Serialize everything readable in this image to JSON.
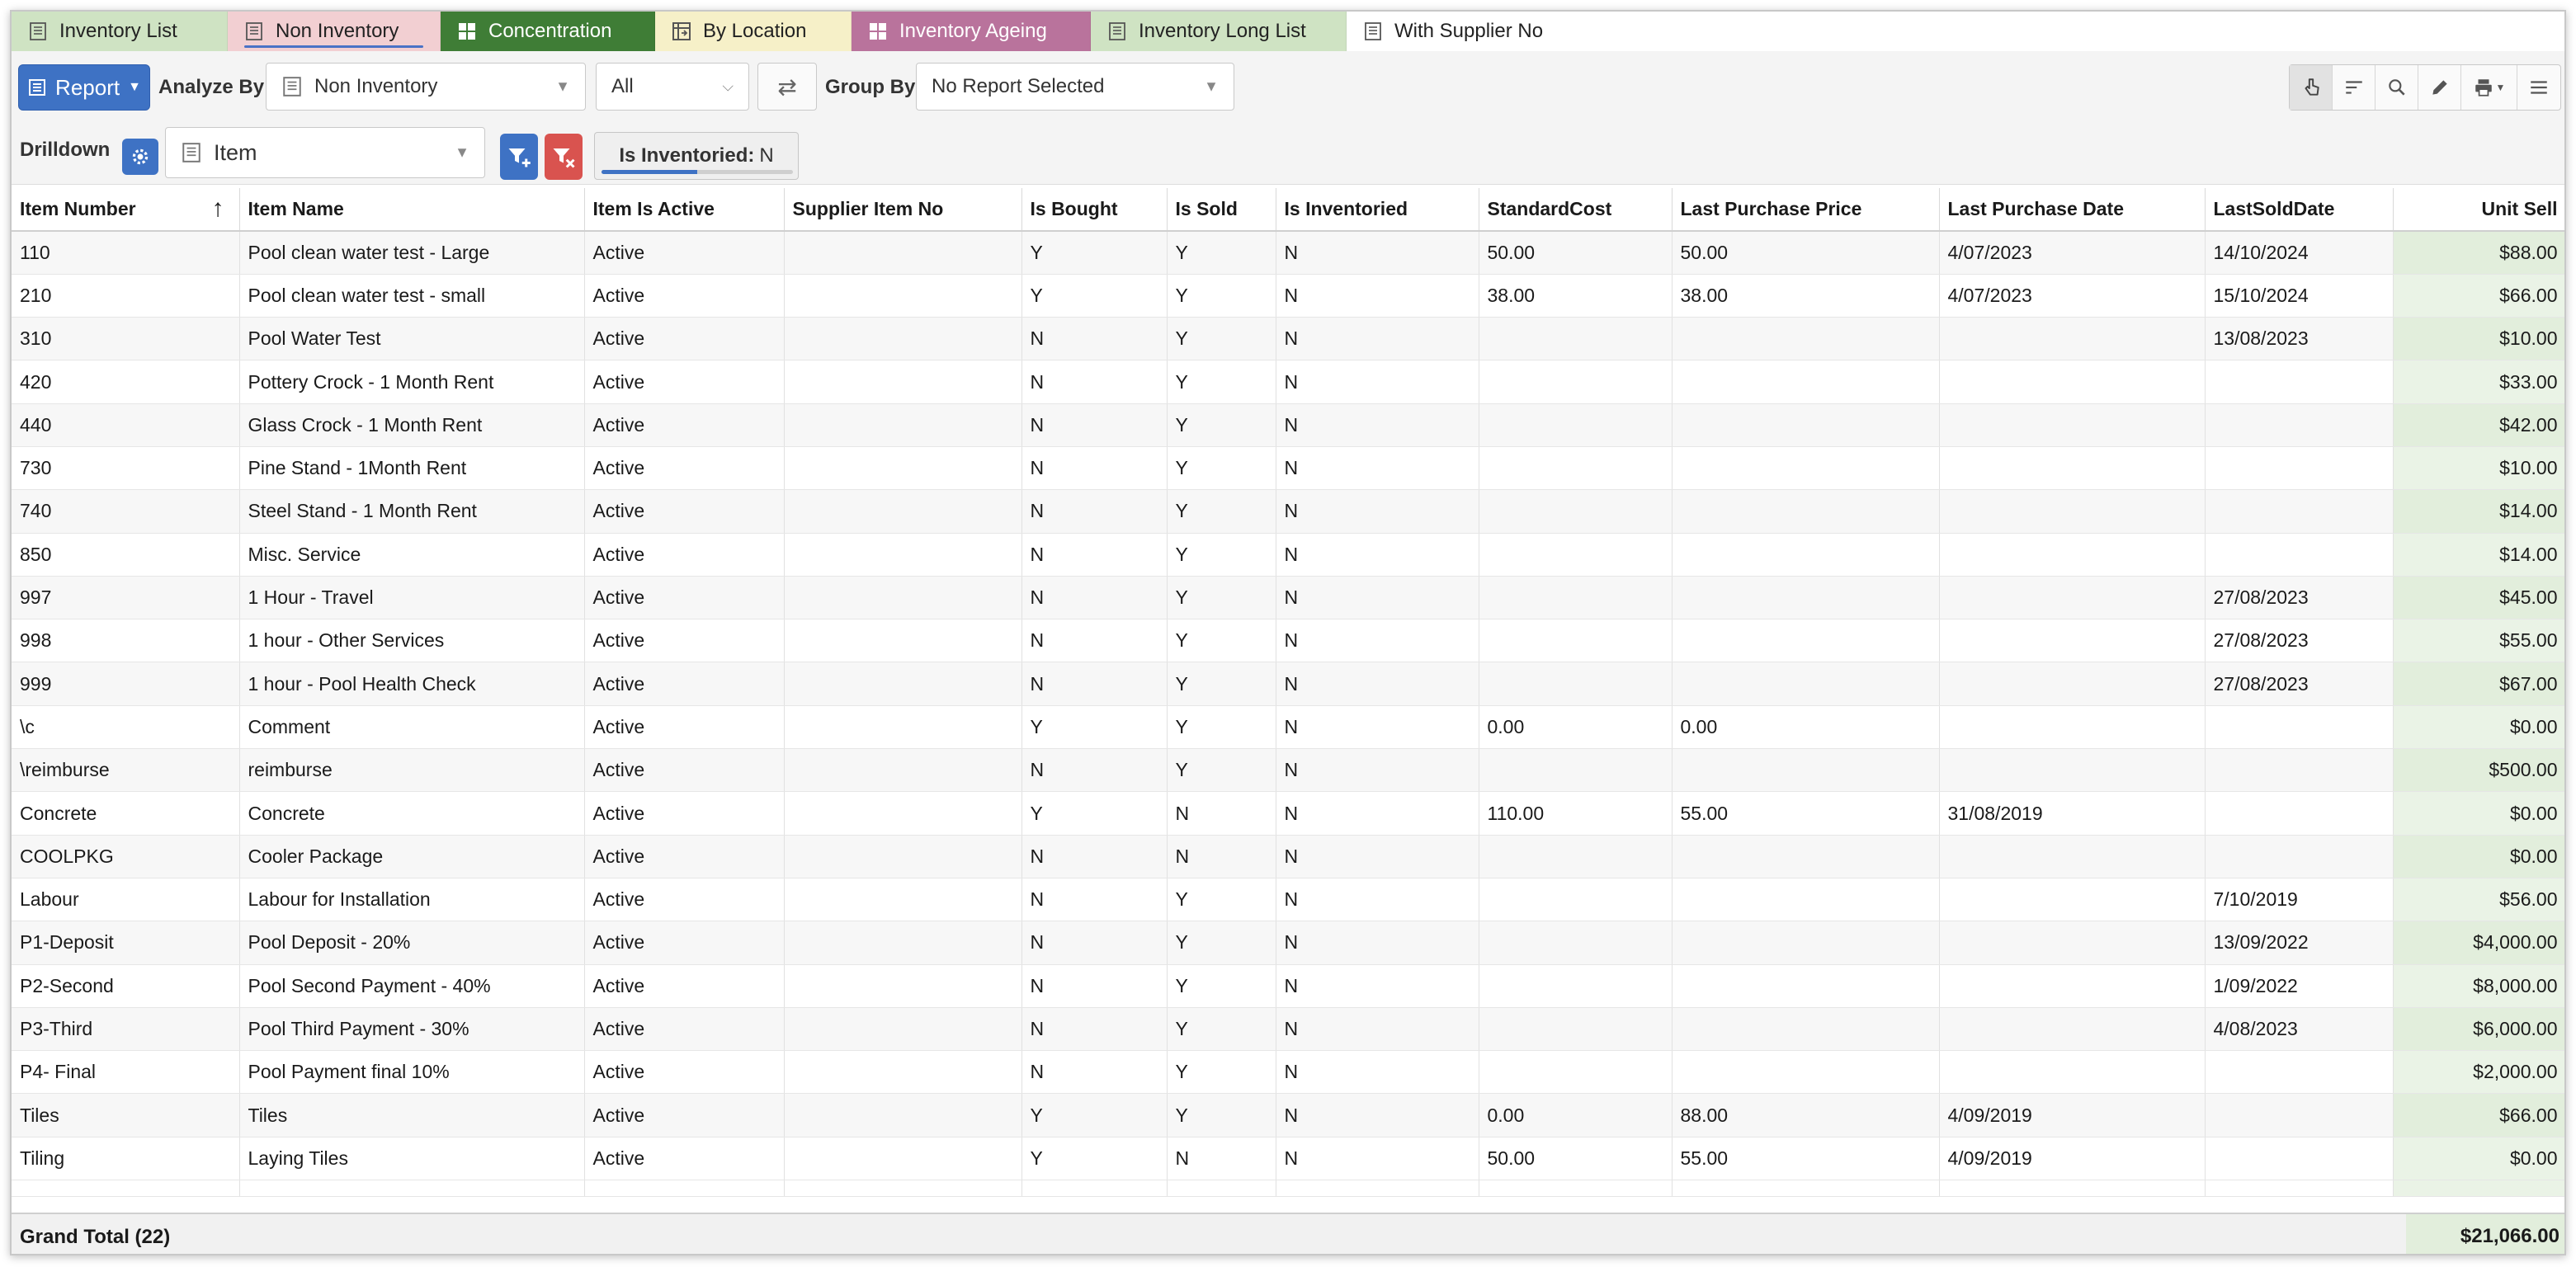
{
  "tabs": [
    {
      "label": "Inventory List",
      "color": "#cfe3c3",
      "icon": "list-icon"
    },
    {
      "label": "Non Inventory",
      "color": "#f2cfd2",
      "icon": "list-icon",
      "active": true
    },
    {
      "label": "Concentration",
      "color": "#3f7d36",
      "icon": "dashboard-icon",
      "text_color": "#ffffff"
    },
    {
      "label": "By Location",
      "color": "#f6f0c8",
      "icon": "pivot-icon"
    },
    {
      "label": "Inventory Ageing",
      "color": "#b9739c",
      "icon": "dashboard-icon",
      "text_color": "#ffffff"
    },
    {
      "label": "Inventory Long List",
      "color": "#cfe3c3",
      "icon": "list-icon"
    },
    {
      "label": "With Supplier No",
      "color": "#ffffff",
      "icon": "list-icon"
    }
  ],
  "toolbar": {
    "report_label": "Report",
    "analyze_by_label": "Analyze By",
    "analyze_by_value": "Non Inventory",
    "filter_value": "All",
    "group_by_label": "Group By",
    "group_by_value": "No Report Selected",
    "drilldown_label": "Drilldown",
    "drilldown_value": "Item",
    "chip_label": "Is Inventoried:",
    "chip_value": "N",
    "chip_progress": 0.5
  },
  "table": {
    "columns": [
      "Item Number",
      "Item Name",
      "Item Is Active",
      "Supplier Item No",
      "Is Bought",
      "Is Sold",
      "Is Inventoried",
      "StandardCost",
      "Last Purchase Price",
      "Last Purchase Date",
      "LastSoldDate",
      "Unit Sell"
    ],
    "rows": [
      [
        "110",
        "Pool clean water test - Large",
        "Active",
        "",
        "Y",
        "Y",
        "N",
        "50.00",
        "50.00",
        "4/07/2023",
        "14/10/2024",
        "$88.00"
      ],
      [
        "210",
        "Pool clean water test - small",
        "Active",
        "",
        "Y",
        "Y",
        "N",
        "38.00",
        "38.00",
        "4/07/2023",
        "15/10/2024",
        "$66.00"
      ],
      [
        "310",
        "Pool Water Test",
        "Active",
        "",
        "N",
        "Y",
        "N",
        "",
        "",
        "",
        "13/08/2023",
        "$10.00"
      ],
      [
        "420",
        "Pottery Crock - 1 Month Rent",
        "Active",
        "",
        "N",
        "Y",
        "N",
        "",
        "",
        "",
        "",
        "$33.00"
      ],
      [
        "440",
        "Glass Crock - 1 Month Rent",
        "Active",
        "",
        "N",
        "Y",
        "N",
        "",
        "",
        "",
        "",
        "$42.00"
      ],
      [
        "730",
        "Pine Stand - 1Month Rent",
        "Active",
        "",
        "N",
        "Y",
        "N",
        "",
        "",
        "",
        "",
        "$10.00"
      ],
      [
        "740",
        "Steel Stand - 1 Month Rent",
        "Active",
        "",
        "N",
        "Y",
        "N",
        "",
        "",
        "",
        "",
        "$14.00"
      ],
      [
        "850",
        "Misc. Service",
        "Active",
        "",
        "N",
        "Y",
        "N",
        "",
        "",
        "",
        "",
        "$14.00"
      ],
      [
        "997",
        "1 Hour - Travel",
        "Active",
        "",
        "N",
        "Y",
        "N",
        "",
        "",
        "",
        "27/08/2023",
        "$45.00"
      ],
      [
        "998",
        "1 hour - Other Services",
        "Active",
        "",
        "N",
        "Y",
        "N",
        "",
        "",
        "",
        "27/08/2023",
        "$55.00"
      ],
      [
        "999",
        "1 hour - Pool Health Check",
        "Active",
        "",
        "N",
        "Y",
        "N",
        "",
        "",
        "",
        "27/08/2023",
        "$67.00"
      ],
      [
        "\\c",
        "Comment",
        "Active",
        "",
        "Y",
        "Y",
        "N",
        "0.00",
        "0.00",
        "",
        "",
        "$0.00"
      ],
      [
        "\\reimburse",
        "reimburse",
        "Active",
        "",
        "N",
        "Y",
        "N",
        "",
        "",
        "",
        "",
        "$500.00"
      ],
      [
        "Concrete",
        "Concrete",
        "Active",
        "",
        "Y",
        "N",
        "N",
        "110.00",
        "55.00",
        "31/08/2019",
        "",
        "$0.00"
      ],
      [
        "COOLPKG",
        "Cooler Package",
        "Active",
        "",
        "N",
        "N",
        "N",
        "",
        "",
        "",
        "",
        "$0.00"
      ],
      [
        "Labour",
        "Labour for Installation",
        "Active",
        "",
        "N",
        "Y",
        "N",
        "",
        "",
        "",
        "7/10/2019",
        "$56.00"
      ],
      [
        "P1-Deposit",
        "Pool Deposit - 20%",
        "Active",
        "",
        "N",
        "Y",
        "N",
        "",
        "",
        "",
        "13/09/2022",
        "$4,000.00"
      ],
      [
        "P2-Second",
        "Pool Second Payment - 40%",
        "Active",
        "",
        "N",
        "Y",
        "N",
        "",
        "",
        "",
        "1/09/2022",
        "$8,000.00"
      ],
      [
        "P3-Third",
        "Pool Third Payment - 30%",
        "Active",
        "",
        "N",
        "Y",
        "N",
        "",
        "",
        "",
        "4/08/2023",
        "$6,000.00"
      ],
      [
        "P4- Final",
        "Pool Payment final 10%",
        "Active",
        "",
        "N",
        "Y",
        "N",
        "",
        "",
        "",
        "",
        "$2,000.00"
      ],
      [
        "Tiles",
        "Tiles",
        "Active",
        "",
        "Y",
        "Y",
        "N",
        "0.00",
        "88.00",
        "4/09/2019",
        "",
        "$66.00"
      ],
      [
        "Tiling",
        "Laying Tiles",
        "Active",
        "",
        "Y",
        "N",
        "N",
        "50.00",
        "55.00",
        "4/09/2019",
        "",
        "$0.00"
      ]
    ]
  },
  "footer": {
    "grand_total_label": "Grand Total (22)",
    "grand_total_value": "$21,066.00"
  },
  "colors": {
    "accent": "#3e72c4",
    "filter_remove": "#d9534f",
    "unit_sell_bg": "#eaf3e6"
  }
}
